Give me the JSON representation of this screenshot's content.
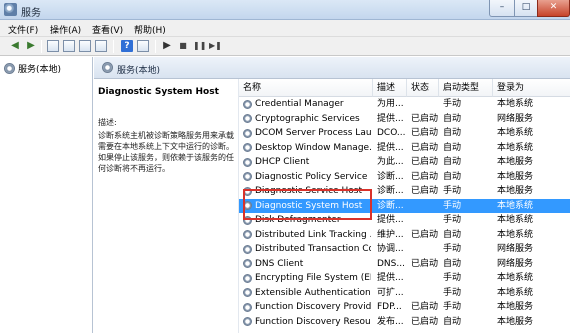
{
  "window": {
    "title": "服务",
    "min_symbol": "–",
    "max_symbol": "□",
    "close_symbol": "✕"
  },
  "menu": [
    "文件(F)",
    "操作(A)",
    "查看(V)",
    "帮助(H)"
  ],
  "toolbar": {
    "back": "◀",
    "forward": "▶",
    "help": "?",
    "play": "▶",
    "stop": "■",
    "pause": "❚❚",
    "restart": "▶❚"
  },
  "tree": {
    "root_label": "服务(本地)"
  },
  "pane_header": {
    "label": "服务(本地)"
  },
  "detail": {
    "service_name": "Diagnostic System Host",
    "description_label": "描述:",
    "description_text": "诊断系统主机被诊断策略服务用来承载需要在本地系统上下文中运行的诊断。如果停止该服务，则依赖于该服务的任何诊断将不再运行。"
  },
  "columns": {
    "name": "名称",
    "desc": "描述",
    "status": "状态",
    "startup": "启动类型",
    "logon": "登录为"
  },
  "rows": [
    {
      "name": "Credential Manager",
      "desc": "为用...",
      "status": "",
      "startup": "手动",
      "logon": "本地系统"
    },
    {
      "name": "Cryptographic Services",
      "desc": "提供...",
      "status": "已启动",
      "startup": "自动",
      "logon": "网络服务"
    },
    {
      "name": "DCOM Server Process Lau...",
      "desc": "DCO...",
      "status": "已启动",
      "startup": "自动",
      "logon": "本地系统"
    },
    {
      "name": "Desktop Window Manage...",
      "desc": "提供...",
      "status": "已启动",
      "startup": "自动",
      "logon": "本地系统"
    },
    {
      "name": "DHCP Client",
      "desc": "为此...",
      "status": "已启动",
      "startup": "自动",
      "logon": "本地服务"
    },
    {
      "name": "Diagnostic Policy Service",
      "desc": "诊断...",
      "status": "已启动",
      "startup": "自动",
      "logon": "本地服务"
    },
    {
      "name": "Diagnostic Service Host",
      "desc": "诊断...",
      "status": "已启动",
      "startup": "手动",
      "logon": "本地服务"
    },
    {
      "name": "Diagnostic System Host",
      "desc": "诊断...",
      "status": "",
      "startup": "手动",
      "logon": "本地系统"
    },
    {
      "name": "Disk Defragmenter",
      "desc": "提供...",
      "status": "",
      "startup": "手动",
      "logon": "本地系统"
    },
    {
      "name": "Distributed Link Tracking ...",
      "desc": "维护...",
      "status": "已启动",
      "startup": "自动",
      "logon": "本地系统"
    },
    {
      "name": "Distributed Transaction Co...",
      "desc": "协调...",
      "status": "",
      "startup": "手动",
      "logon": "网络服务"
    },
    {
      "name": "DNS Client",
      "desc": "DNS...",
      "status": "已启动",
      "startup": "自动",
      "logon": "网络服务"
    },
    {
      "name": "Encrypting File System (EFS)",
      "desc": "提供...",
      "status": "",
      "startup": "手动",
      "logon": "本地系统"
    },
    {
      "name": "Extensible Authentication P...",
      "desc": "可扩...",
      "status": "",
      "startup": "手动",
      "logon": "本地系统"
    },
    {
      "name": "Function Discovery Provide...",
      "desc": "FDP...",
      "status": "已启动",
      "startup": "手动",
      "logon": "本地服务"
    },
    {
      "name": "Function Discovery Resour...",
      "desc": "发布...",
      "status": "已启动",
      "startup": "自动",
      "logon": "本地服务"
    }
  ],
  "selected_row_index": 7,
  "colors": {
    "selection": "#3399ff",
    "highlight_border": "#d9322b",
    "title_gradient_top": "#dbe8f6"
  }
}
